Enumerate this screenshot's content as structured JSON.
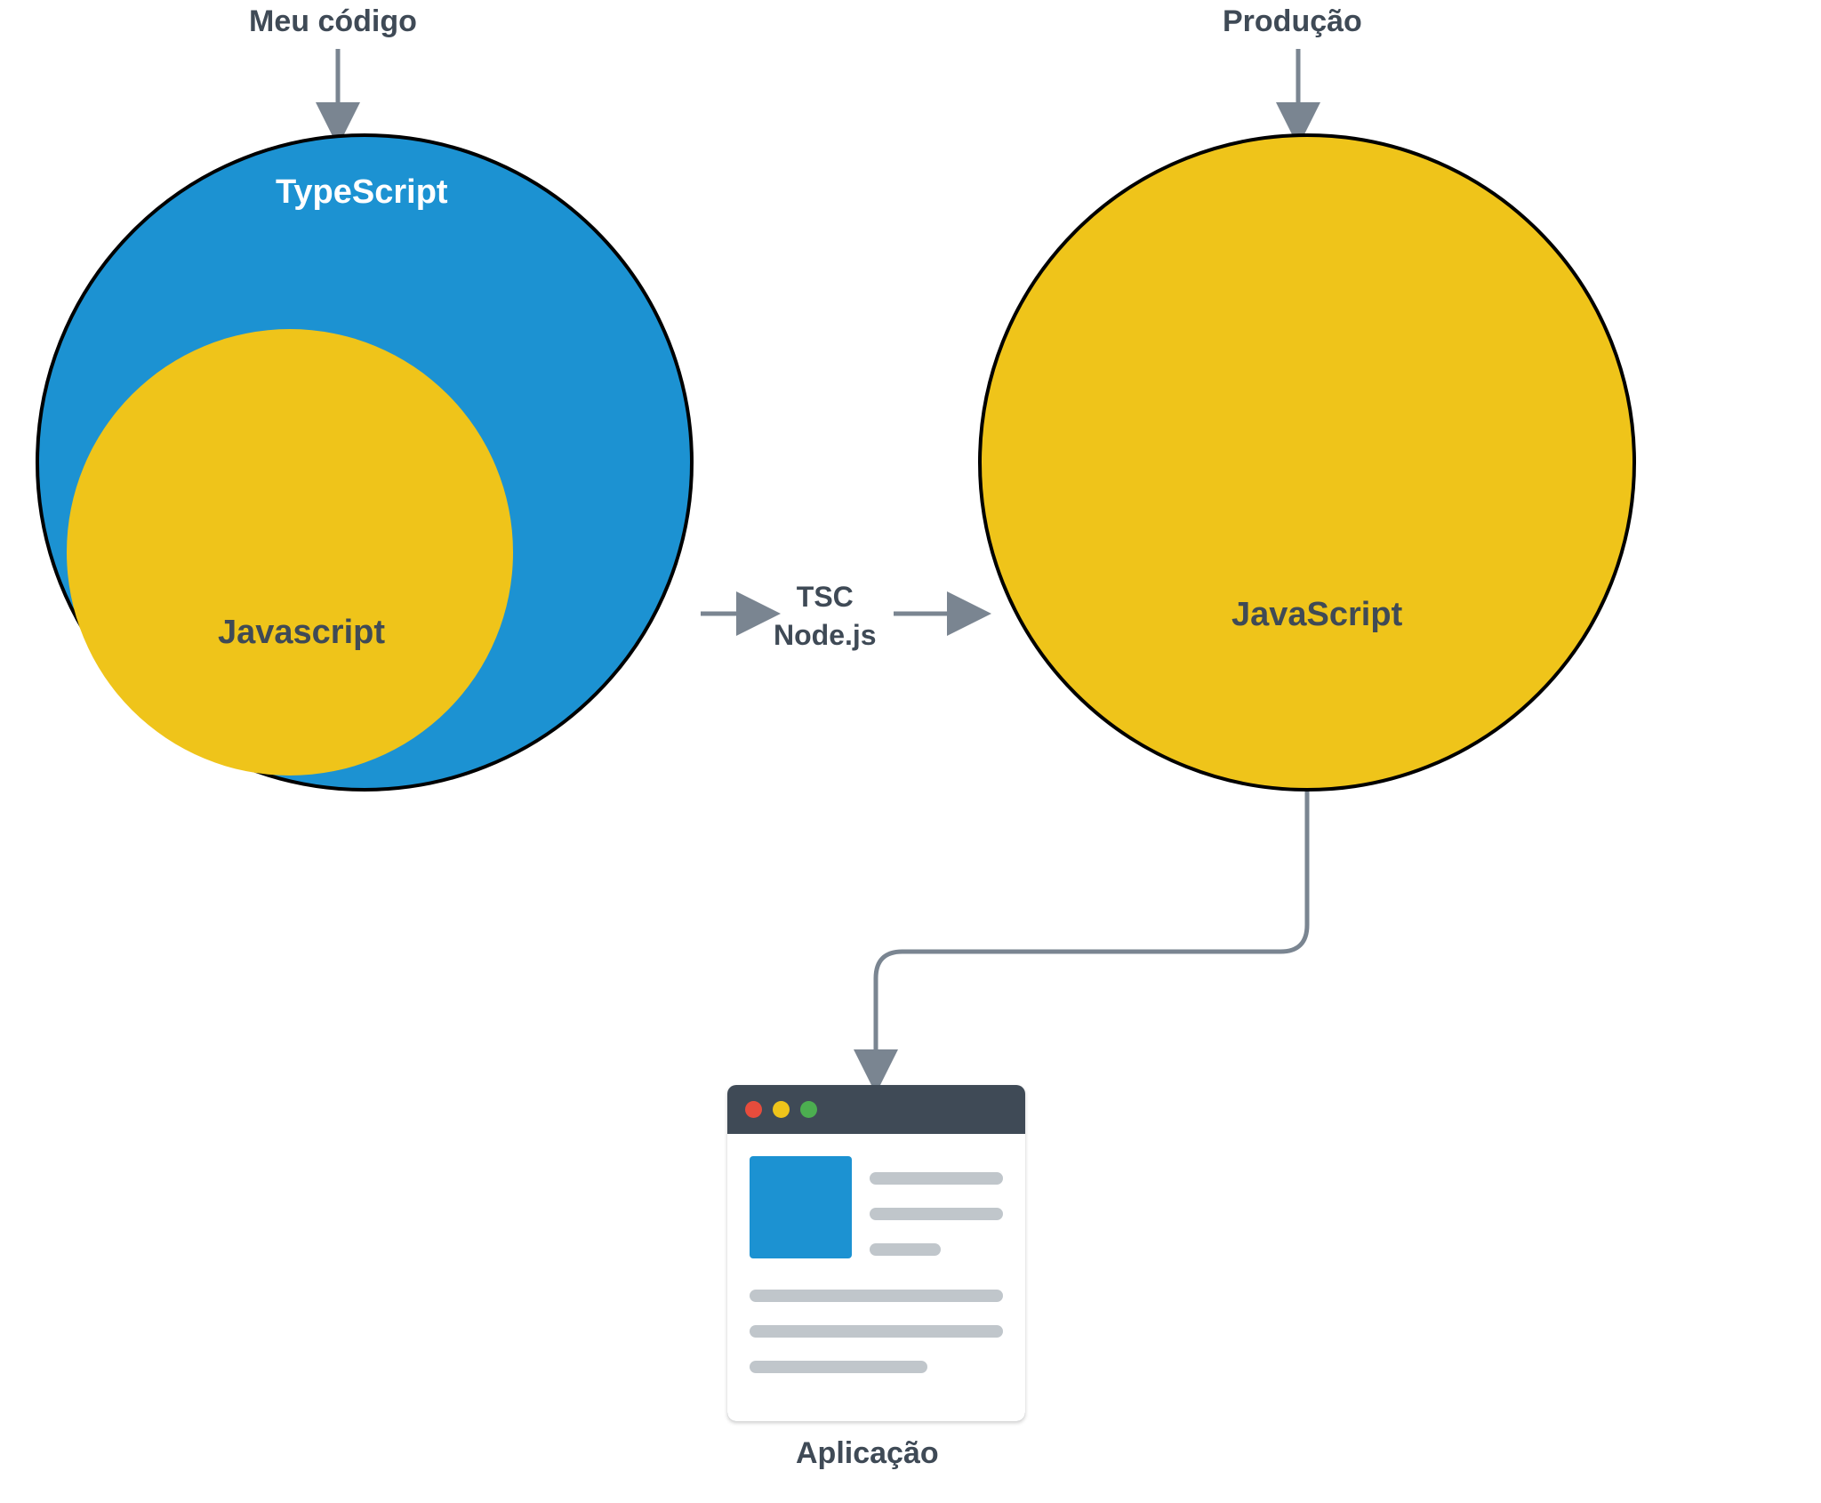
{
  "labels": {
    "my_code": "Meu código",
    "production": "Produção",
    "typescript": "TypeScript",
    "javascript_inner": "Javascript",
    "javascript_right": "JavaScript",
    "compiler_line1": "TSC",
    "compiler_line2": "Node.js",
    "application": "Aplicação"
  },
  "colors": {
    "typescript_blue": "#1c92d2",
    "javascript_yellow": "#efc41a",
    "text_dark": "#3f4a56",
    "arrow_gray": "#7a8591"
  }
}
